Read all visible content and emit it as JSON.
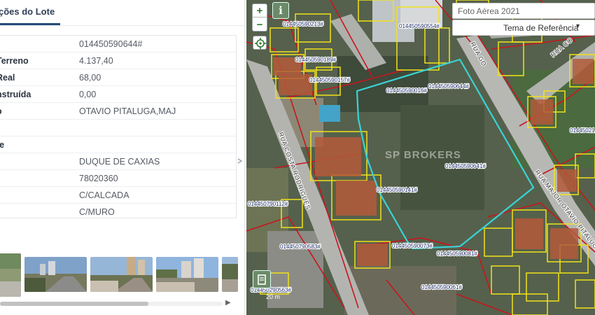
{
  "panel": {
    "tab_label": "ções do Lote",
    "rows": [
      {
        "key": "",
        "value": "014450590644#"
      },
      {
        "key": "Terreno",
        "value": "4.137,40"
      },
      {
        "key": "Real",
        "value": "68,00"
      },
      {
        "key": "nstruída",
        "value": "0,00"
      },
      {
        "key": "o",
        "value": "OTAVIO PITALUGA,MAJ"
      },
      {
        "key": "",
        "value": ""
      },
      {
        "key": "te",
        "value": ""
      },
      {
        "key": "",
        "value": "DUQUE DE CAXIAS"
      },
      {
        "key": "",
        "value": "78020360"
      },
      {
        "key": "",
        "value": "C/CALCADA"
      },
      {
        "key": "",
        "value": "C/MURO"
      }
    ],
    "scroll_right_arrow": "▶"
  },
  "map": {
    "zoom_in": "+",
    "zoom_out": "−",
    "info_button": "i",
    "basemap": "Foto Aérea 2021",
    "theme": "Tema de Referência",
    "theme_caret": "▾",
    "watermark": "SP BROKERS",
    "scale": "20 m",
    "parcel_labels": [
      "014450590213#",
      "014450590554#",
      "014450590189#",
      "014450590157#",
      "014450590644#",
      "014450590641#",
      "014450590141#",
      "014450790112#",
      "014450790583#",
      "014450590073#",
      "014450590081#",
      "014450590061#",
      "014450290563#",
      "014450590016#",
      "01445021"
    ],
    "street_labels": [
      "RUA COSTA RODRIGUES",
      "RUA MAJOR OTAVIO PITALUGA",
      "RUA GO",
      "RUA CO"
    ]
  },
  "colors": {
    "accent": "#244a78",
    "parcel_yellow": "#f2e21a",
    "block_red": "#c8161e",
    "selected_cyan": "#39d3d6"
  }
}
